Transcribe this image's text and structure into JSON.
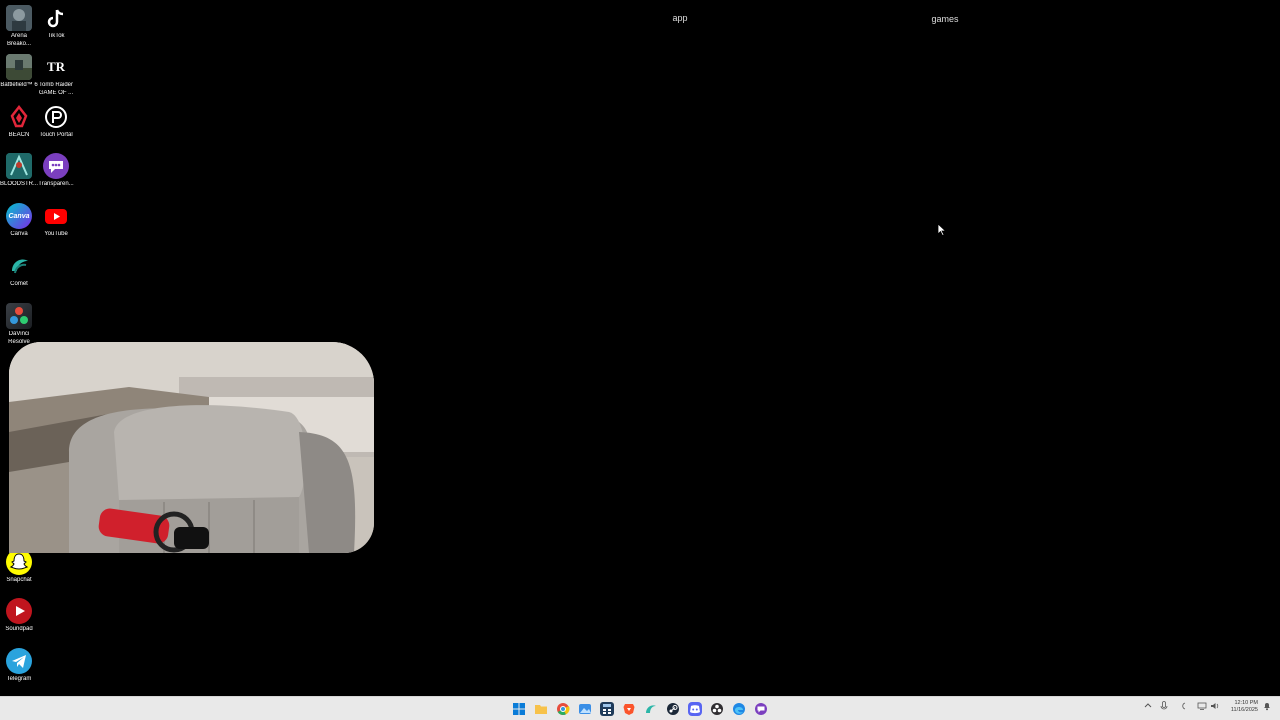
{
  "desktop": {
    "folder_labels": {
      "app": "app",
      "games": "games"
    },
    "icons": [
      {
        "label": "Arena",
        "label2": "Breako...",
        "icon": "arena-breakout-icon"
      },
      {
        "label": "TikTok",
        "icon": "tiktok-icon"
      },
      {
        "label": "Battlefield™ 6",
        "icon": "battlefield-icon"
      },
      {
        "label": "Tomb Raider",
        "label2": "GAME OF ...",
        "icon": "tomb-raider-icon"
      },
      {
        "label": "BEACN",
        "icon": "beacn-icon"
      },
      {
        "label": "Touch Portal",
        "icon": "touch-portal-icon"
      },
      {
        "label": "BLOODSTR...",
        "icon": "bloodstrike-icon"
      },
      {
        "label": "Transparen...",
        "icon": "transparent-chat-icon"
      },
      {
        "label": "Canva",
        "icon": "canva-icon"
      },
      {
        "label": "YouTube",
        "icon": "youtube-icon"
      },
      {
        "label": "Comet",
        "icon": "comet-icon"
      },
      {
        "label": "DaVinci",
        "label2": "Resolve",
        "icon": "davinci-resolve-icon"
      },
      {
        "label": "Snapchat",
        "icon": "snapchat-icon"
      },
      {
        "label": "Soundpad",
        "icon": "soundpad-icon"
      },
      {
        "label": "Telegram",
        "icon": "telegram-icon"
      }
    ]
  },
  "taskbar": {
    "apps": [
      "start-icon",
      "file-explorer-icon",
      "chrome-icon",
      "photos-icon",
      "calculator-icon",
      "brave-icon",
      "comet-icon",
      "steam-icon",
      "discord-icon",
      "obs-icon",
      "edge-icon",
      "transparent-chat-icon"
    ],
    "clock": {
      "time": "12:10 PM",
      "date": "11/16/2025"
    }
  },
  "colors": {
    "desktop_bg": "#000000",
    "taskbar_bg": "#e9e9e9"
  }
}
